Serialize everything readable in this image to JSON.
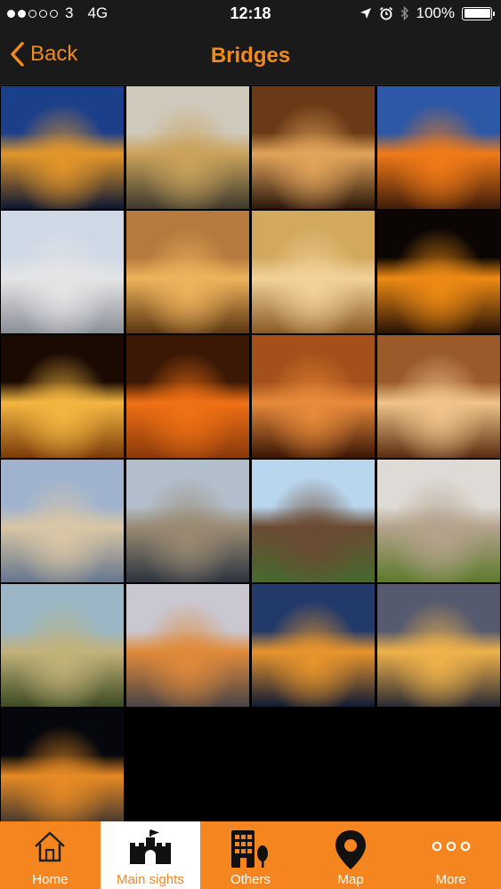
{
  "status_bar": {
    "signal_dots_filled": 2,
    "signal_dots_total": 5,
    "carrier": "3",
    "network": "4G",
    "time": "12:18",
    "battery_percent_text": "100%",
    "battery_level": 1.0
  },
  "nav": {
    "back_label": "Back",
    "title": "Bridges"
  },
  "gallery": {
    "tiles": [
      {
        "name": "bridge-night-blue-sky",
        "c1": "#1c3f8a",
        "c2": "#e2962a",
        "c3": "#0c1733"
      },
      {
        "name": "bridge-willow-dusk",
        "c1": "#cfc9bb",
        "c2": "#caa25a",
        "c3": "#3c3a2e"
      },
      {
        "name": "arch-corridor-lit",
        "c1": "#6a3a16",
        "c2": "#e2a45a",
        "c3": "#2a160a"
      },
      {
        "name": "arch-blue-tile",
        "c1": "#2c58a6",
        "c2": "#f07a18",
        "c3": "#401c08"
      },
      {
        "name": "stone-lion-statue",
        "c1": "#cfd9e5",
        "c2": "#e5e5e5",
        "c3": "#8a8f97"
      },
      {
        "name": "bridge-arcade-reflection",
        "c1": "#b57a3c",
        "c2": "#efb35c",
        "c3": "#5a3612"
      },
      {
        "name": "painted-ceiling-niche",
        "c1": "#d3a95e",
        "c2": "#f2d29a",
        "c3": "#8a5a26"
      },
      {
        "name": "bridge-night-reflection",
        "c1": "#0b0603",
        "c2": "#ee8a14",
        "c3": "#2a1405"
      },
      {
        "name": "corridor-lights-perspective",
        "c1": "#1a0a02",
        "c2": "#f4b640",
        "c3": "#7a3a0a"
      },
      {
        "name": "brick-arches-lit",
        "c1": "#3a1805",
        "c2": "#f07014",
        "c3": "#8a3a0c"
      },
      {
        "name": "arch-tunnel-orange",
        "c1": "#a4501a",
        "c2": "#e88a3a",
        "c3": "#3a1606"
      },
      {
        "name": "arch-passage-daylight",
        "c1": "#9a5a2a",
        "c2": "#f0c48a",
        "c3": "#5a2c10"
      },
      {
        "name": "bridge-day-water",
        "c1": "#9fb3cf",
        "c2": "#d9c6a5",
        "c3": "#64758e"
      },
      {
        "name": "bridge-two-tiers-dusk",
        "c1": "#b2becb",
        "c2": "#9a8a72",
        "c3": "#2c3440"
      },
      {
        "name": "bronze-sculpture-park",
        "c1": "#b9d6ef",
        "c2": "#6b4a32",
        "c3": "#466a2e"
      },
      {
        "name": "bridge-yellow-flowers",
        "c1": "#dedad5",
        "c2": "#b4a38c",
        "c3": "#5c7a2a"
      },
      {
        "name": "bridge-green-trees",
        "c1": "#9bb7c5",
        "c2": "#c2b27a",
        "c3": "#3c4a22"
      },
      {
        "name": "bridge-evening-people",
        "c1": "#c9c7d0",
        "c2": "#e08a3a",
        "c3": "#4a4446"
      },
      {
        "name": "bridge-blue-hour",
        "c1": "#223a6a",
        "c2": "#e7942c",
        "c3": "#0e1a34"
      },
      {
        "name": "bridge-twilight-reflection",
        "c1": "#565a6e",
        "c2": "#f0b24a",
        "c3": "#2a2a34"
      },
      {
        "name": "bridge-arches-night-water",
        "c1": "#06070c",
        "c2": "#e68a24",
        "c3": "#2a2a30"
      }
    ]
  },
  "tabs": [
    {
      "label": "Home",
      "icon": "home-icon",
      "active": false
    },
    {
      "label": "Main sights",
      "icon": "castle-icon",
      "active": true
    },
    {
      "label": "Others",
      "icon": "buildings-icon",
      "active": false
    },
    {
      "label": "Map",
      "icon": "map-pin-icon",
      "active": false
    },
    {
      "label": "More",
      "icon": "more-dots-icon",
      "active": false
    }
  ],
  "colors": {
    "accent": "#f5861f",
    "nav_text": "#f28a1e",
    "bar_background": "#1a1a1a",
    "tab_active_background": "#ffffff"
  }
}
